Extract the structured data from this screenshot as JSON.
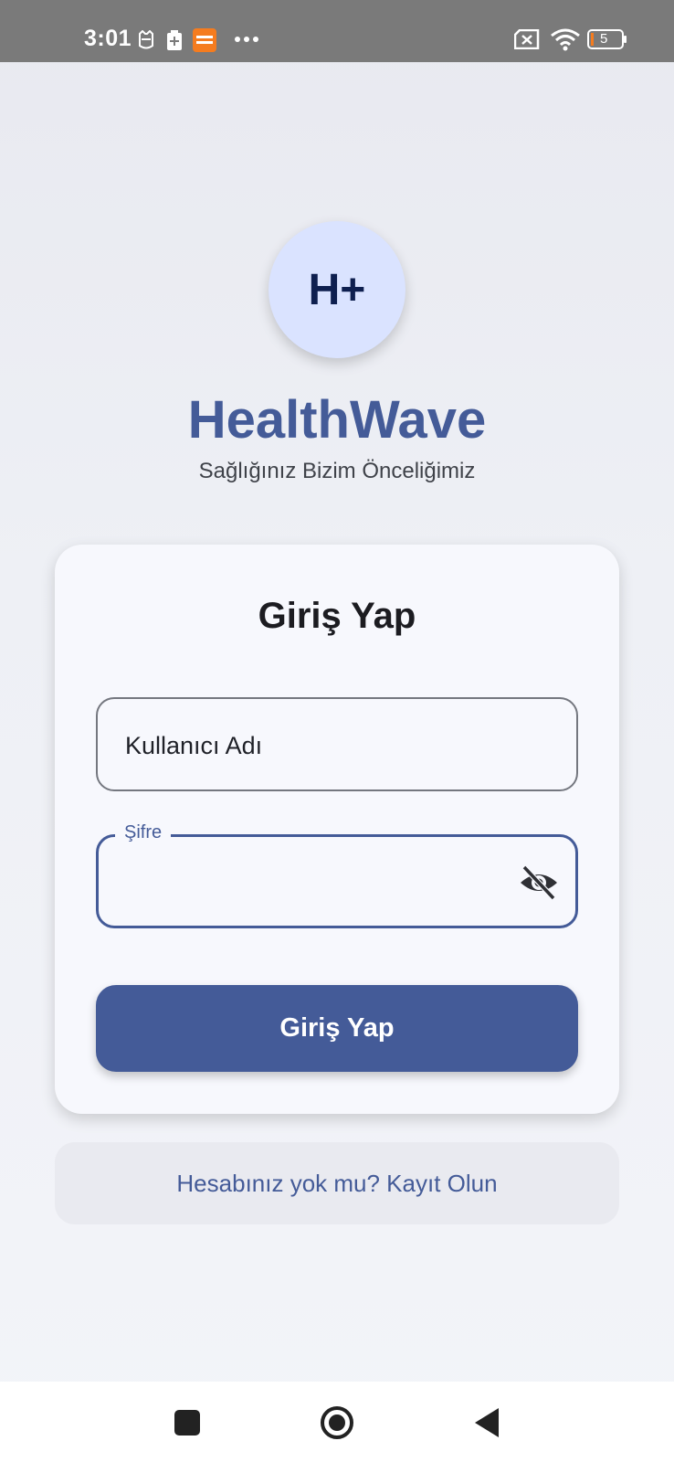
{
  "status_bar": {
    "time": "3:01",
    "battery_level": "5",
    "icons": [
      "cat-notification-icon",
      "battery-saver-icon",
      "temu-app-icon",
      "more-dots-icon",
      "sim-error-icon",
      "wifi-icon",
      "battery-icon"
    ]
  },
  "header": {
    "logo_text": "H+",
    "app_name": "HealthWave",
    "tagline": "Sağlığınız Bizim Önceliğimiz"
  },
  "login_card": {
    "title": "Giriş Yap",
    "username_field": {
      "placeholder": "Kullanıcı Adı",
      "value": ""
    },
    "password_field": {
      "label": "Şifre",
      "value": "",
      "visibility_icon": "eye-off-icon"
    },
    "submit_label": "Giriş Yap"
  },
  "register": {
    "label": "Hesabınız yok mu? Kayıt Olun"
  },
  "nav_bar": {
    "buttons": [
      "recents-square-icon",
      "home-circle-icon",
      "back-triangle-icon"
    ]
  },
  "colors": {
    "primary": "#445b98",
    "logo_bg": "#dae3ff",
    "status_bar": "#7a7a7a"
  }
}
